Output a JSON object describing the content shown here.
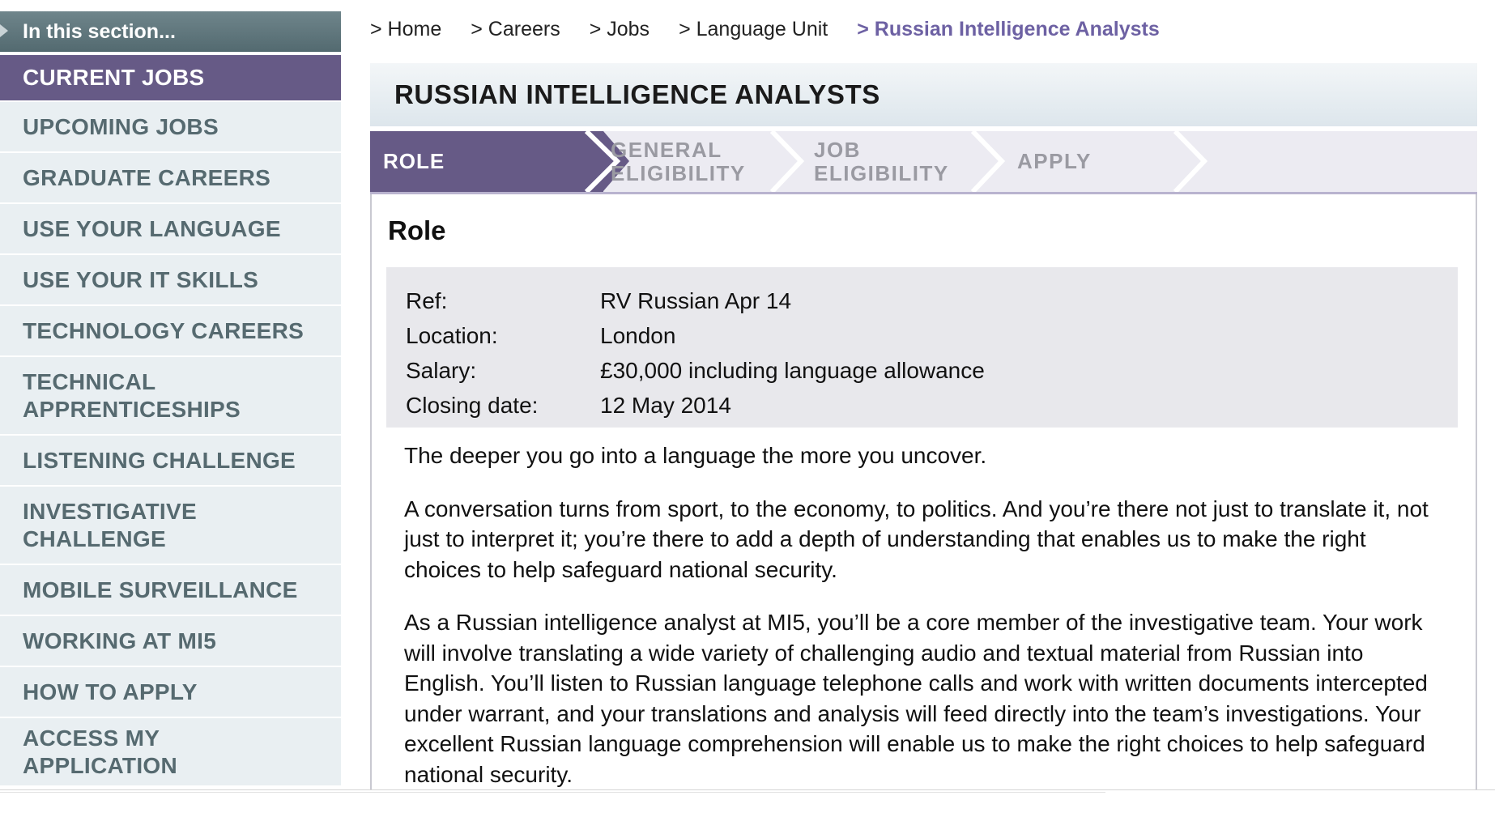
{
  "sidebar": {
    "header": "In this section...",
    "items": [
      {
        "label": "CURRENT JOBS"
      },
      {
        "label": "UPCOMING JOBS"
      },
      {
        "label": "GRADUATE CAREERS"
      },
      {
        "label": "USE YOUR LANGUAGE"
      },
      {
        "label": "USE YOUR IT SKILLS"
      },
      {
        "label": "TECHNOLOGY CAREERS"
      },
      {
        "label": "TECHNICAL APPRENTICESHIPS"
      },
      {
        "label": "LISTENING CHALLENGE"
      },
      {
        "label": "INVESTIGATIVE CHALLENGE"
      },
      {
        "label": "MOBILE SURVEILLANCE"
      },
      {
        "label": "WORKING AT MI5"
      },
      {
        "label": "HOW TO APPLY"
      },
      {
        "label": "ACCESS MY APPLICATION"
      }
    ]
  },
  "breadcrumb": [
    "> Home",
    "> Careers",
    "> Jobs",
    "> Language Unit",
    "> Russian Intelligence Analysts"
  ],
  "page": {
    "title": "RUSSIAN INTELLIGENCE ANALYSTS"
  },
  "steps": [
    "ROLE",
    "GENERAL ELIGIBILITY",
    "JOB ELIGIBILITY",
    "APPLY"
  ],
  "content": {
    "heading": "Role",
    "info": [
      {
        "label": "Ref:",
        "value": "RV Russian Apr 14"
      },
      {
        "label": "Location:",
        "value": "London"
      },
      {
        "label": "Salary:",
        "value": "£30,000 including language allowance"
      },
      {
        "label": "Closing date:",
        "value": "12 May 2014"
      }
    ],
    "paragraphs": [
      "The deeper you go into a language the more you uncover.",
      "A conversation turns from sport, to the economy, to politics. And you’re there not just to translate it, not just to interpret it; you’re there to add a depth of understanding that enables us to make the right choices to help safeguard national security.",
      "As a Russian intelligence analyst at MI5, you’ll be a core member of the investigative team. Your work will involve translating a wide variety of challenging audio and textual material from Russian into English. You’ll listen to Russian language telephone calls and work with written documents intercepted under warrant, and your translations and analysis will feed directly into the team’s investigations. Your excellent Russian language comprehension will enable us to make the right choices to help safeguard national security."
    ]
  },
  "colors": {
    "accent": "#665a86",
    "sidebar_bg": "#e9eff2",
    "sidebar_text": "#566a70",
    "breadcrumb_current": "#6d61a3"
  }
}
